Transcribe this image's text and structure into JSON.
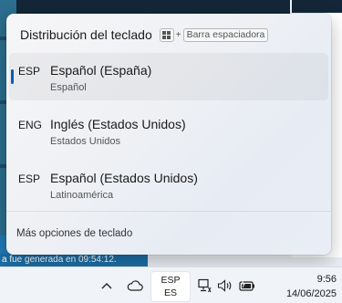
{
  "background": {
    "status_text": "a fue generada en 09:54:12."
  },
  "flyout": {
    "title": "Distribución del teclado",
    "shortcut": {
      "plus": "+",
      "key": "Barra espaciadora"
    },
    "items": [
      {
        "code": "ESP",
        "name": "Español (España)",
        "sub": "Español",
        "selected": true
      },
      {
        "code": "ENG",
        "name": "Inglés (Estados Unidos)",
        "sub": "Estados Unidos",
        "selected": false
      },
      {
        "code": "ESP",
        "name": "Español (Estados Unidos)",
        "sub": "Latinoamérica",
        "selected": false
      }
    ],
    "more_options": "Más opciones de teclado"
  },
  "taskbar": {
    "language": {
      "code": "ESP",
      "region": "ES"
    },
    "clock": {
      "time": "9:56",
      "date": "14/06/2025"
    },
    "tray_icons": [
      "chevron-up-icon",
      "cloud-icon",
      "network-icon",
      "volume-icon",
      "battery-icon"
    ]
  },
  "colors": {
    "accent": "#005fb8"
  }
}
